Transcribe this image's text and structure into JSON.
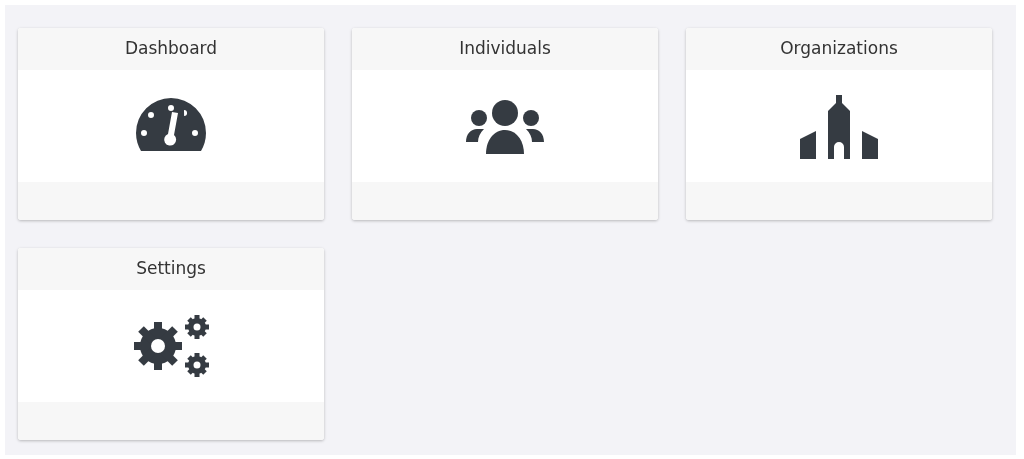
{
  "cards": [
    {
      "title": "Dashboard"
    },
    {
      "title": "Individuals"
    },
    {
      "title": "Organizations"
    },
    {
      "title": "Settings"
    }
  ]
}
